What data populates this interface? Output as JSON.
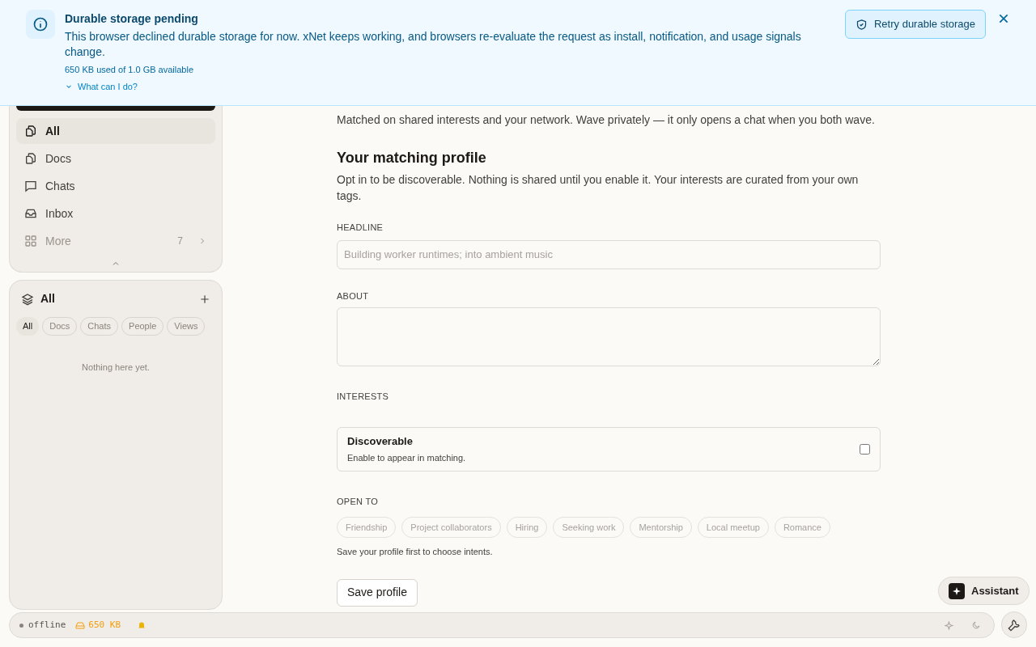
{
  "banner": {
    "title": "Durable storage pending",
    "message": "This browser declined durable storage for now. xNet keeps working, and browsers re-evaluate the request as install, notification, and usage signals change.",
    "usage": "650 KB used of 1.0 GB available",
    "help_link": "What can I do?",
    "action": "Retry durable storage"
  },
  "sidebar": {
    "nav": [
      {
        "label": "All",
        "selected": true
      },
      {
        "label": "Docs",
        "selected": false
      },
      {
        "label": "Chats",
        "selected": false
      },
      {
        "label": "Inbox",
        "selected": false
      },
      {
        "label": "More",
        "selected": false,
        "count": "7"
      }
    ],
    "collection": {
      "title": "All",
      "filters": [
        {
          "label": "All",
          "selected": true
        },
        {
          "label": "Docs",
          "selected": false
        },
        {
          "label": "Chats",
          "selected": false
        },
        {
          "label": "People",
          "selected": false
        },
        {
          "label": "Views",
          "selected": false
        }
      ],
      "empty": "Nothing here yet."
    }
  },
  "main": {
    "intro": "Matched on shared interests and your network. Wave privately — it only opens a chat when you both wave.",
    "profile_title": "Your matching profile",
    "profile_desc": "Opt in to be discoverable. Nothing is shared until you enable it. Your interests are curated from your own tags.",
    "headline": {
      "label": "HEADLINE",
      "placeholder": "Building worker runtimes; into ambient music"
    },
    "about": {
      "label": "ABOUT"
    },
    "interests": {
      "label": "INTERESTS"
    },
    "discoverable": {
      "title": "Discoverable",
      "desc": "Enable to appear in matching.",
      "checked": false
    },
    "open_to": {
      "label": "OPEN TO",
      "options": [
        {
          "label": "Friendship",
          "disabled": true
        },
        {
          "label": "Project collaborators",
          "disabled": true
        },
        {
          "label": "Hiring",
          "disabled": true
        },
        {
          "label": "Seeking work",
          "disabled": true
        },
        {
          "label": "Mentorship",
          "disabled": true
        },
        {
          "label": "Local meetup",
          "disabled": true
        },
        {
          "label": "Romance",
          "disabled": true
        }
      ],
      "hint": "Save your profile first to choose intents."
    },
    "save": "Save profile"
  },
  "assistant": "Assistant",
  "status_bar": {
    "connection": "offline",
    "storage": "650 KB"
  }
}
